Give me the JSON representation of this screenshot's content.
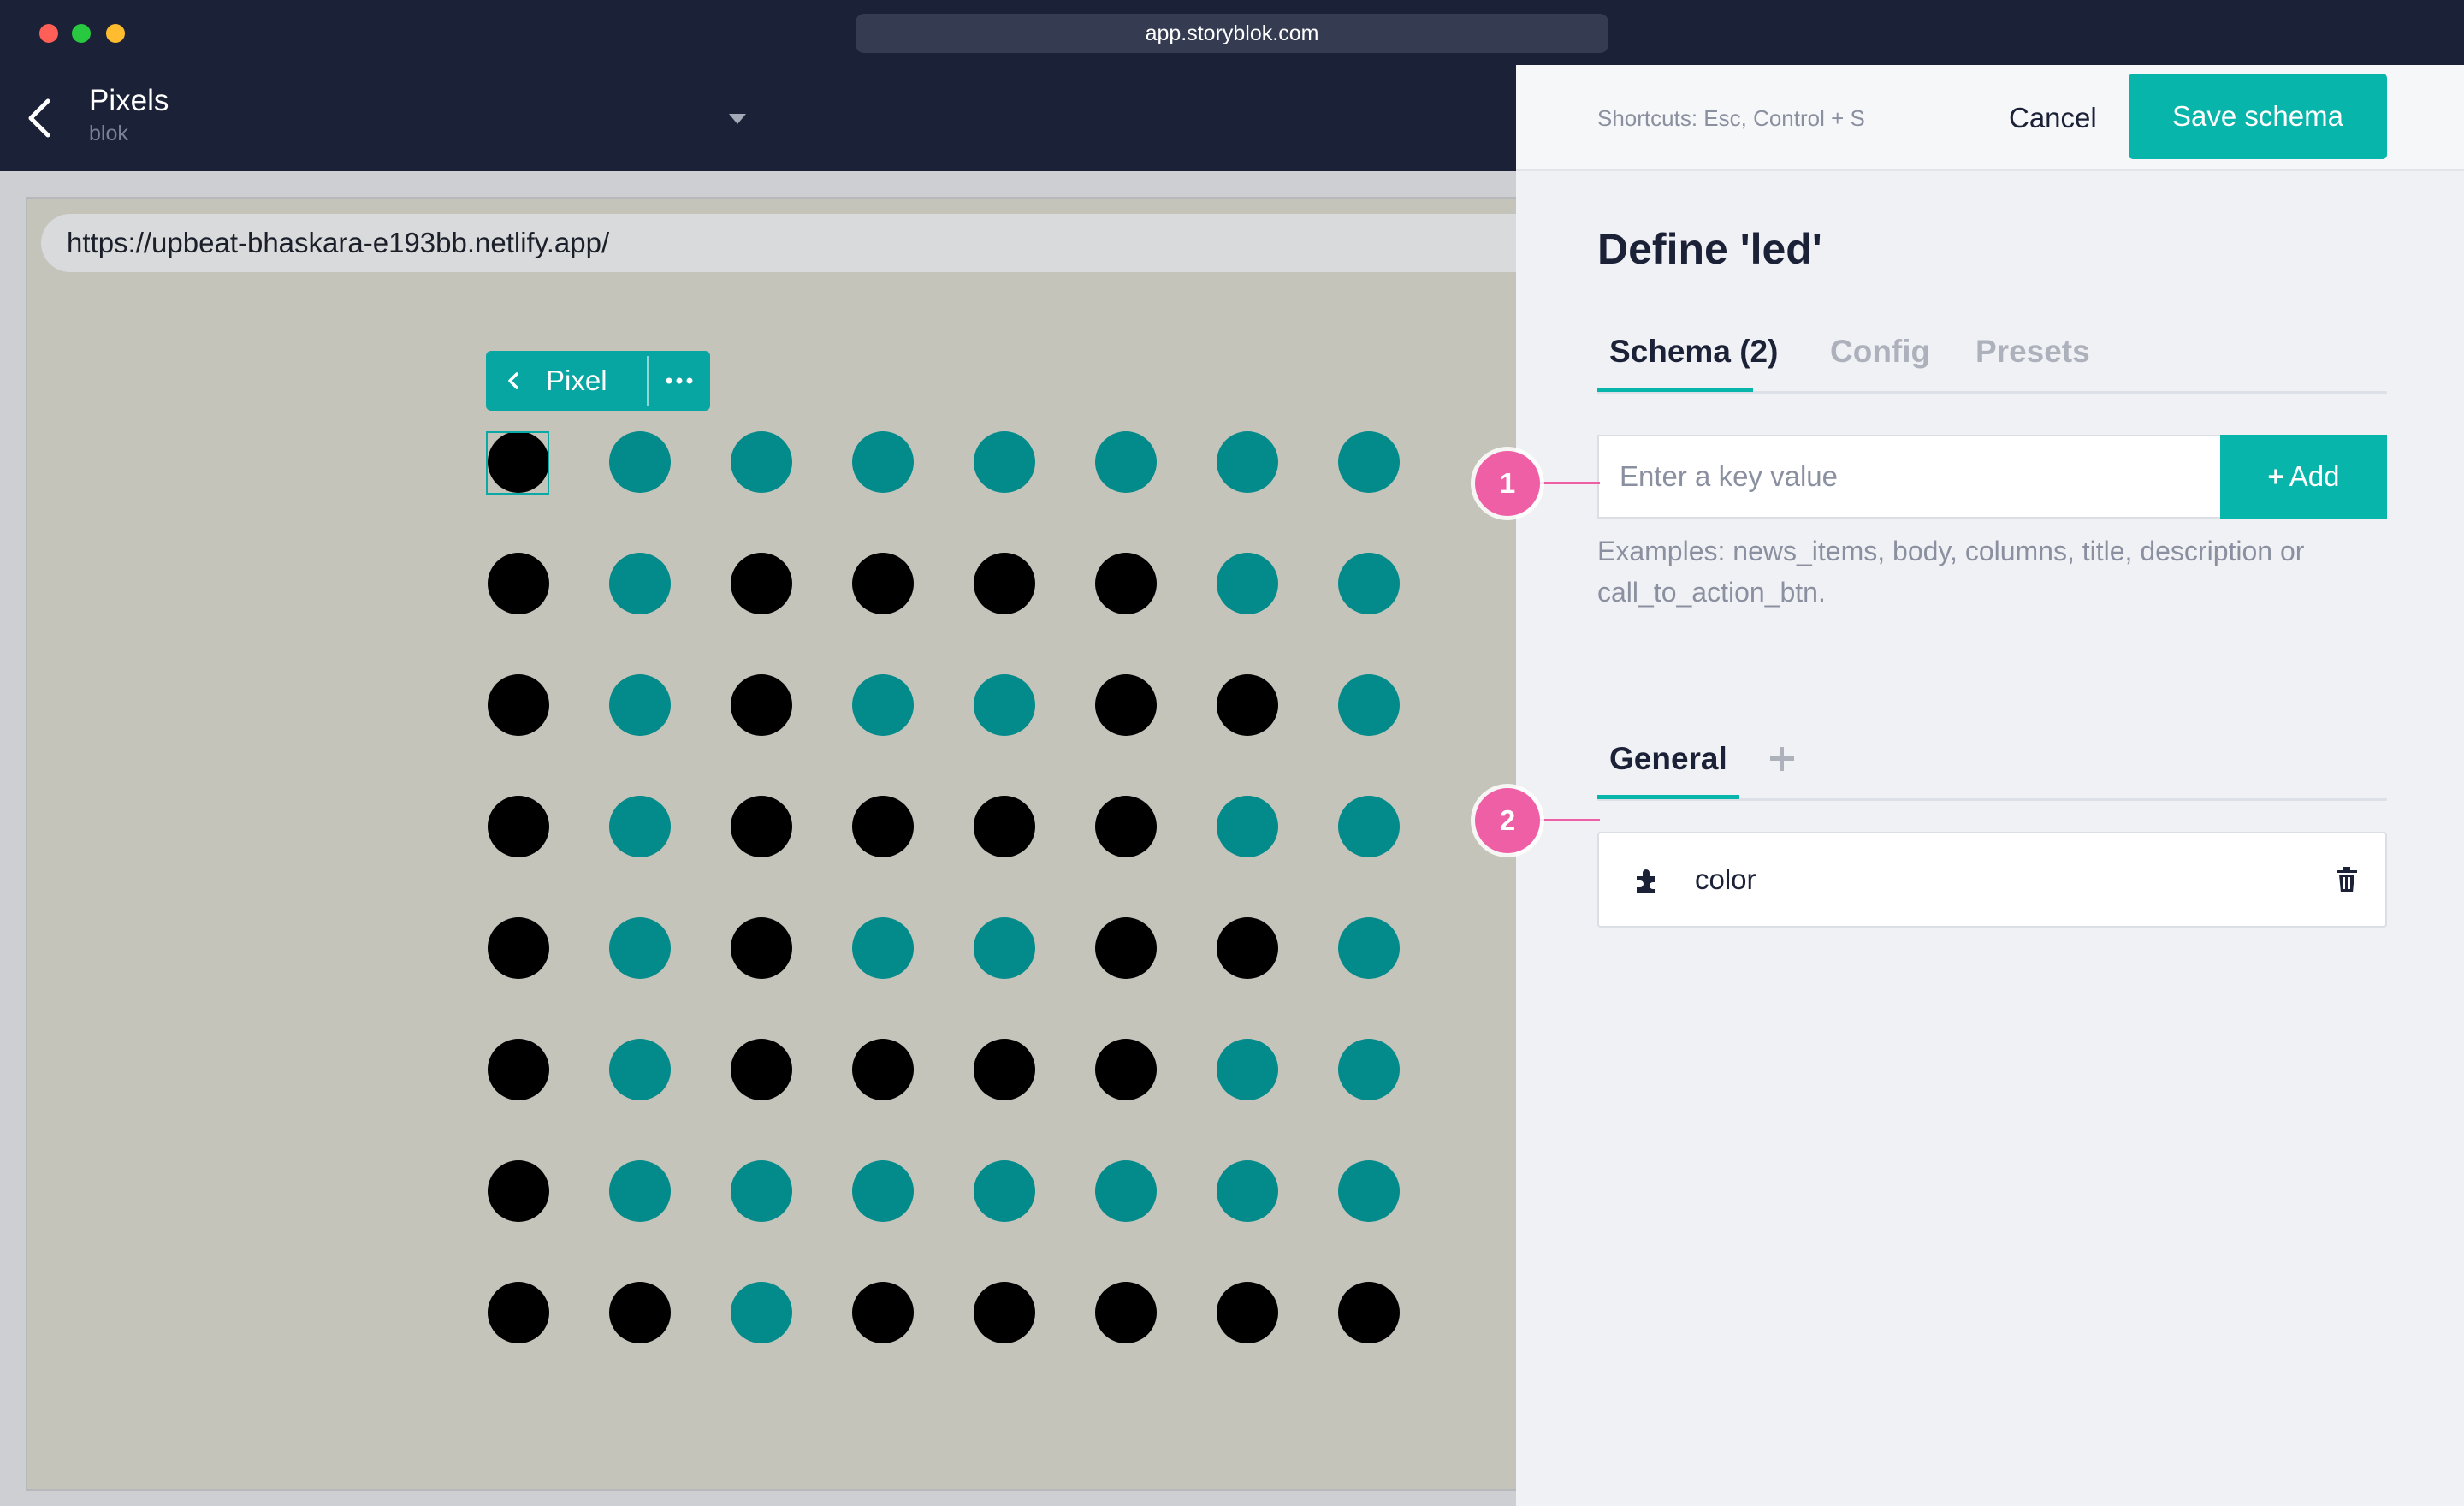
{
  "browser": {
    "address": "app.storyblok.com"
  },
  "header": {
    "title": "Pixels",
    "subtitle": "blok"
  },
  "preview": {
    "url": "https://upbeat-bhaskara-e193bb.netlify.app/",
    "toolbar_label": "Pixel",
    "led_states": [
      [
        "off",
        "on",
        "on",
        "on",
        "on",
        "on",
        "on",
        "on"
      ],
      [
        "off",
        "on",
        "off",
        "off",
        "off",
        "off",
        "on",
        "on"
      ],
      [
        "off",
        "on",
        "off",
        "on",
        "on",
        "off",
        "off",
        "on"
      ],
      [
        "off",
        "on",
        "off",
        "off",
        "off",
        "off",
        "on",
        "on"
      ],
      [
        "off",
        "on",
        "off",
        "on",
        "on",
        "off",
        "off",
        "on"
      ],
      [
        "off",
        "on",
        "off",
        "off",
        "off",
        "off",
        "on",
        "on"
      ],
      [
        "off",
        "on",
        "on",
        "on",
        "on",
        "on",
        "on",
        "on"
      ],
      [
        "off",
        "off",
        "on",
        "off",
        "off",
        "off",
        "off",
        "off"
      ]
    ],
    "colors": {
      "on": "#038a8a",
      "off": "#000000",
      "accent": "#08b5aa"
    }
  },
  "panel": {
    "shortcuts": "Shortcuts: Esc, Control + S",
    "cancel_label": "Cancel",
    "save_label": "Save schema",
    "title": "Define 'led'",
    "tabs": [
      {
        "label": "Schema (2)",
        "active": true
      },
      {
        "label": "Config",
        "active": false
      },
      {
        "label": "Presets",
        "active": false
      }
    ],
    "key_input": {
      "placeholder": "Enter a key value",
      "value": ""
    },
    "add_label": "Add",
    "examples": "Examples: news_items, body, columns, title, description or call_to_action_btn.",
    "group_tab": "General",
    "fields": [
      {
        "name": "color",
        "icon": "puzzle-icon"
      }
    ]
  },
  "callouts": [
    "1",
    "2"
  ]
}
